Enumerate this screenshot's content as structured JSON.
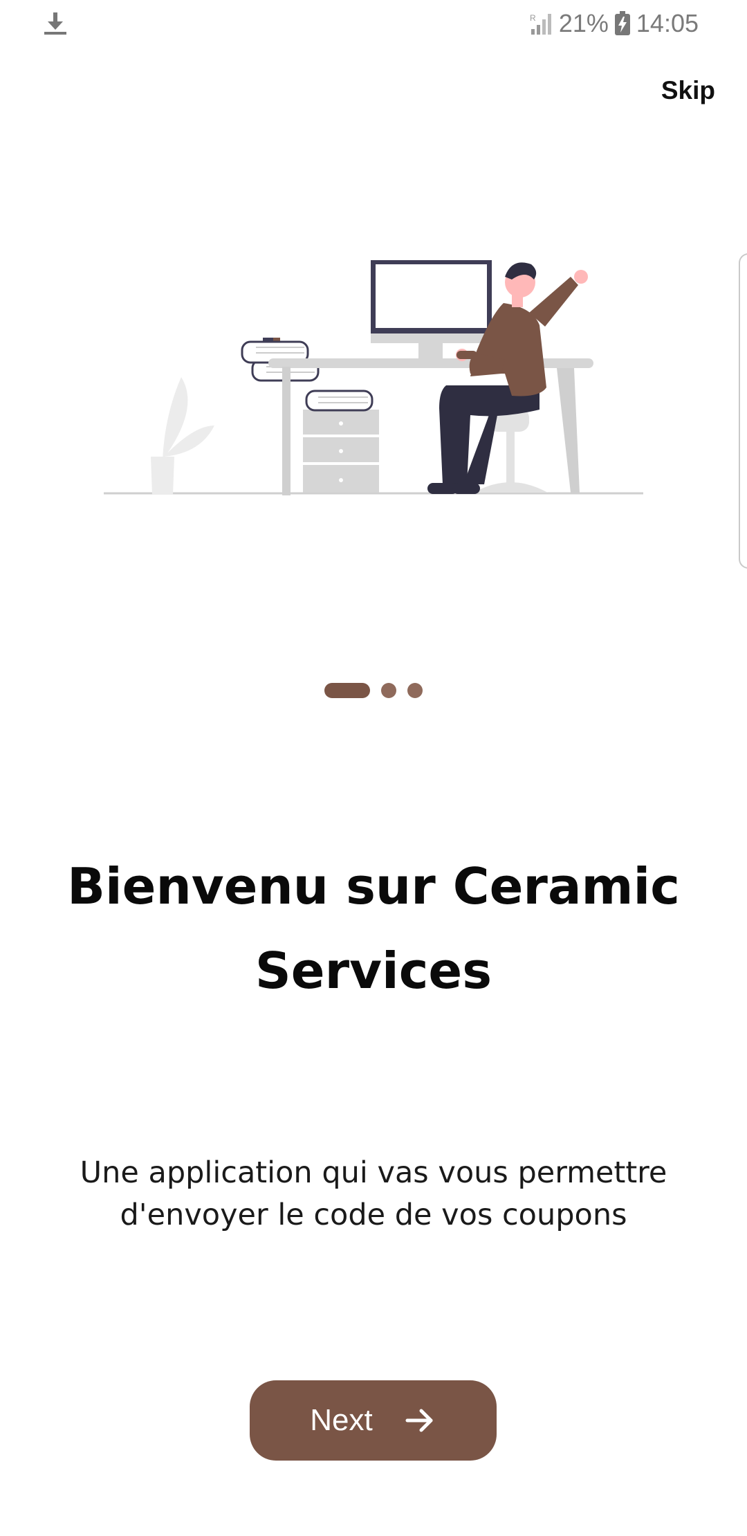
{
  "status_bar": {
    "battery_percent": "21%",
    "time": "14:05",
    "icons": [
      "download-icon",
      "signal-icon",
      "battery-charging-icon"
    ],
    "text_color": "#7a7a7a"
  },
  "skip_label": "Skip",
  "pager": {
    "page_count": 3,
    "current_index": 0,
    "active_color": "#7a5546",
    "inactive_color": "#8f6a5b"
  },
  "title": "Bienvenu sur Ceramic Services",
  "subtitle": "Une application qui vas vous permettre d'envoyer le code de vos coupons",
  "next_button": {
    "label": "Next",
    "icon": "arrow-right-icon",
    "color": "#7a5546"
  },
  "illustration": {
    "description_icon": "person-at-desk-illustration",
    "accent_color": "#7a5546"
  }
}
